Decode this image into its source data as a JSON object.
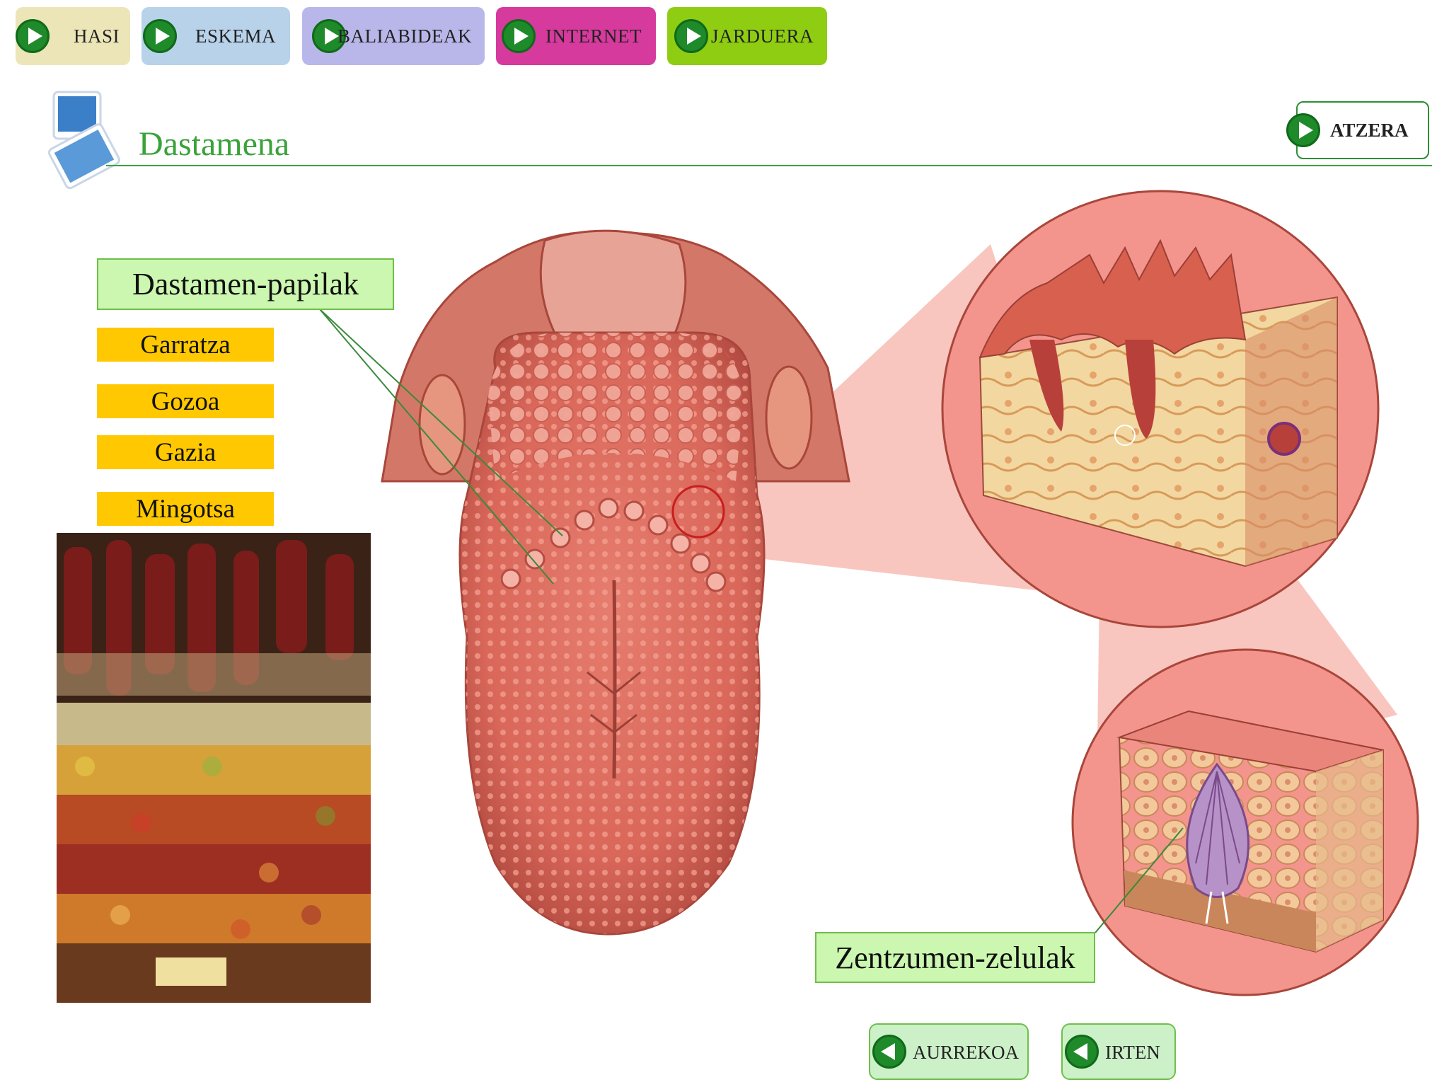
{
  "nav": [
    {
      "label": "HASI",
      "bg": "#ece5b8"
    },
    {
      "label": "ESKEMA",
      "bg": "#b8d2ea"
    },
    {
      "label": "BALIABIDEAK",
      "bg": "#b9b7ea"
    },
    {
      "label": "INTERNET",
      "bg": "#d63a9d"
    },
    {
      "label": "JARDUERA",
      "bg": "#8fcd12"
    }
  ],
  "header": {
    "title": "Dastamena",
    "back_label": "ATZERA"
  },
  "labels": {
    "papillae": "Dastamen-papilak",
    "sensory_cells": "Zentzumen-zelulak"
  },
  "tastes": [
    "Garratza",
    "Gozoa",
    "Gazia",
    "Mingotsa"
  ],
  "footer": {
    "prev_label": "AURREKOA",
    "exit_label": "IRTEN"
  },
  "colors": {
    "accent_green": "#3aa23a",
    "taste_yellow": "#ffc800",
    "label_green": "#ccf7b0"
  }
}
